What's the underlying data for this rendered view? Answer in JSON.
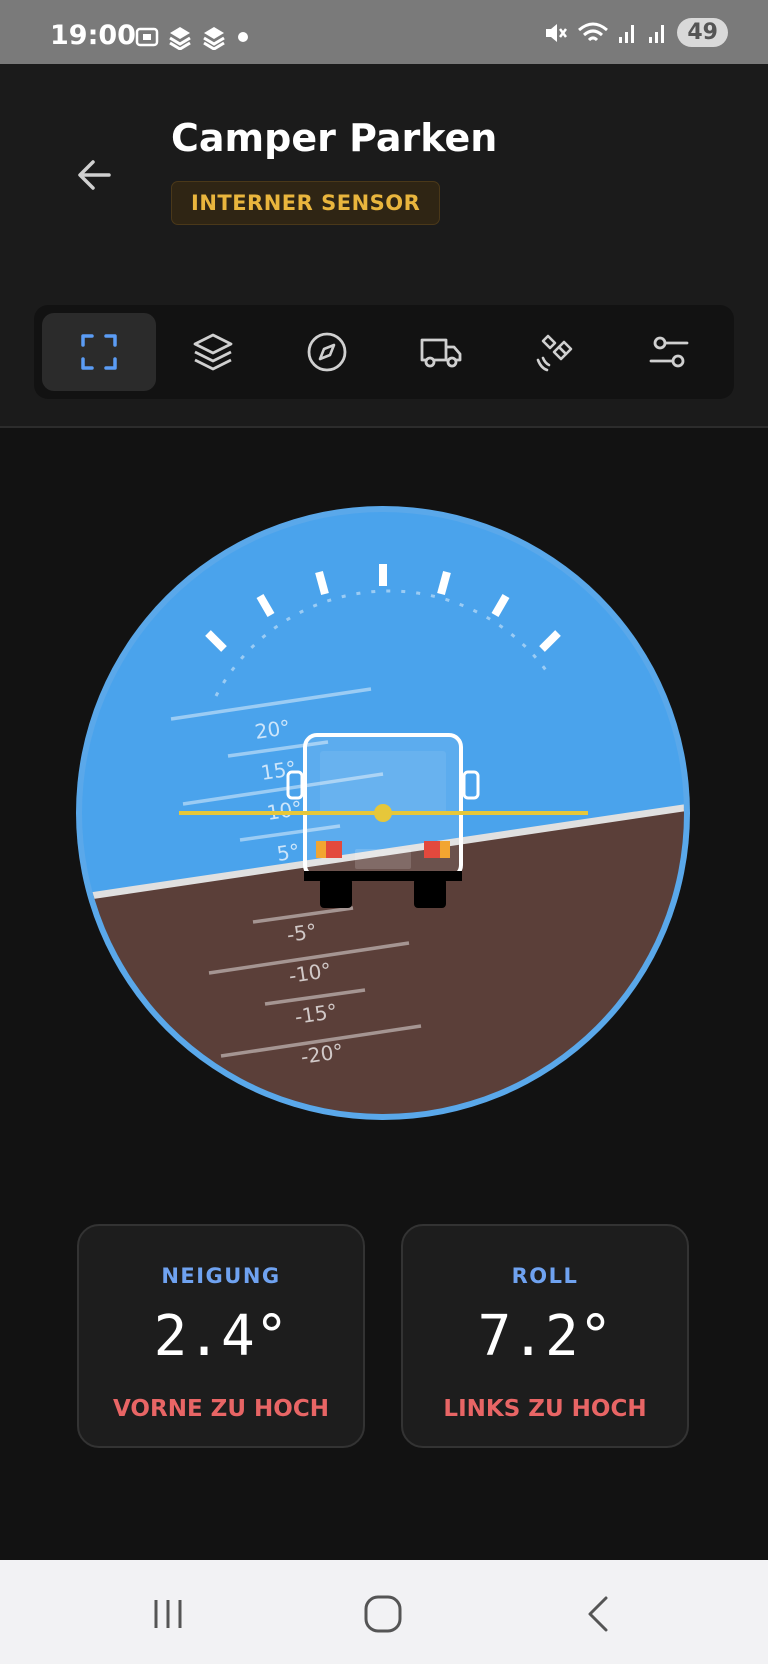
{
  "status_bar": {
    "time": "19:00",
    "battery": "49",
    "icons_left": [
      "screenshot-icon",
      "app-icon",
      "app-icon",
      "dot-icon"
    ],
    "icons_right": [
      "mute-icon",
      "wifi-icon",
      "signal-icon",
      "signal-icon"
    ]
  },
  "header": {
    "back_icon": "arrow-left-icon",
    "title": "Camper Parken",
    "badge": "INTERNER SENSOR"
  },
  "toolbar": {
    "items": [
      {
        "icon": "frame-icon",
        "active": true
      },
      {
        "icon": "layers-icon",
        "active": false
      },
      {
        "icon": "compass-icon",
        "active": false
      },
      {
        "icon": "truck-icon",
        "active": false
      },
      {
        "icon": "satellite-icon",
        "active": false
      },
      {
        "icon": "sliders-icon",
        "active": false
      }
    ]
  },
  "gauge": {
    "pitch_labels": [
      "20°",
      "15°",
      "10°",
      "5°",
      "-5°",
      "-10°",
      "-15°",
      "-20°"
    ],
    "colors": {
      "sky": "#4aa3ec",
      "ground": "#5b3f39",
      "horizon": "#e0e0e0",
      "level_line": "#e6c73a",
      "ring": "#5aa8ea"
    }
  },
  "cards": {
    "pitch": {
      "label": "NEIGUNG",
      "value": "2.4°",
      "status": "VORNE ZU HOCH"
    },
    "roll": {
      "label": "ROLL",
      "value": "7.2°",
      "status": "LINKS ZU HOCH"
    }
  },
  "nav": {
    "items": [
      "recent-apps-icon",
      "home-icon",
      "back-icon"
    ]
  },
  "colors": {
    "accent_blue": "#6fa2f0",
    "warning": "#e86565",
    "badge_text": "#e9b53d"
  }
}
